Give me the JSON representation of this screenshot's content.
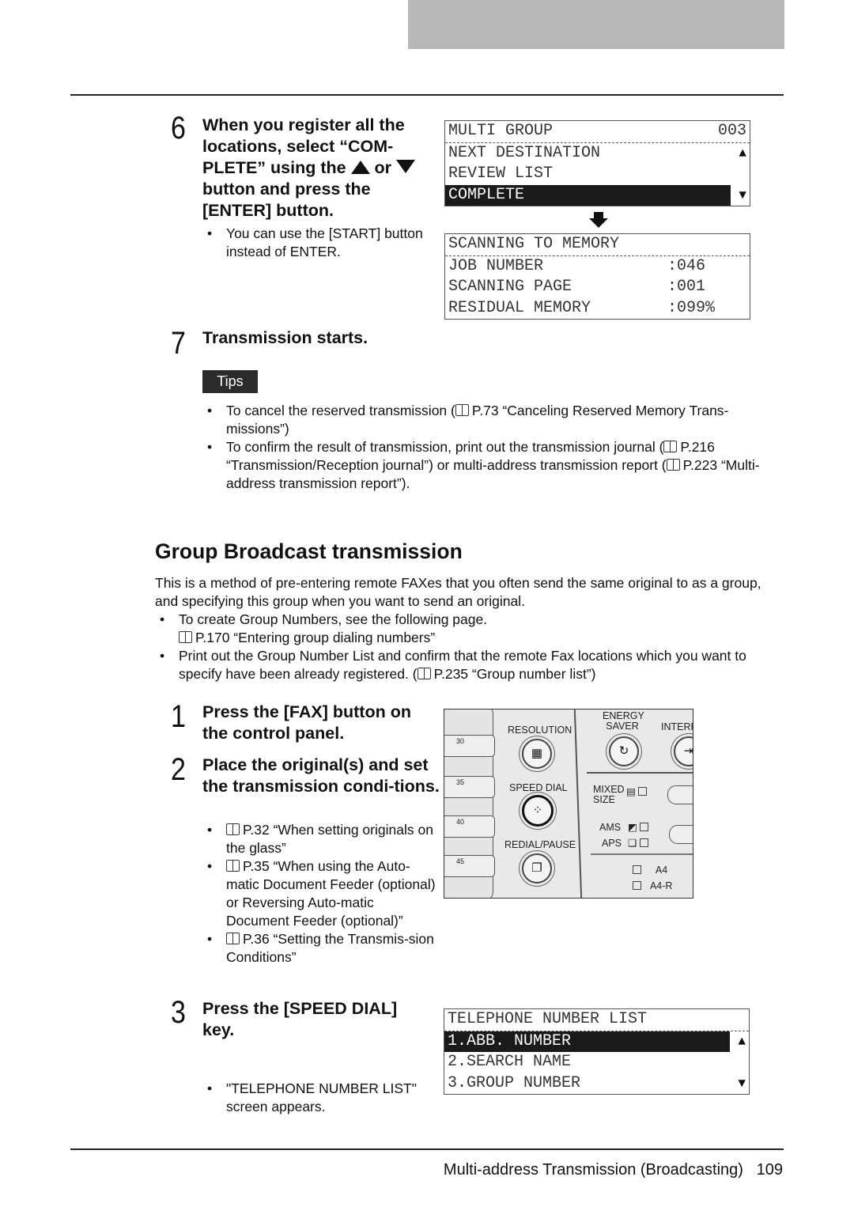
{
  "step6": {
    "num": "6",
    "heading": "When you register all the locations, select “COM-PLETE” using the",
    "heading_or": "or",
    "heading_end": "button and press the [ENTER] button.",
    "bullets": [
      "You can use the [START] button instead of ENTER."
    ]
  },
  "lcd1": {
    "title": "MULTI GROUP",
    "count": "003",
    "rows": [
      "NEXT DESTINATION",
      "REVIEW LIST",
      "COMPLETE"
    ],
    "selected": "COMPLETE"
  },
  "lcd2": {
    "title": "SCANNING TO MEMORY",
    "rows": [
      {
        "label": "JOB NUMBER",
        "value": ":046"
      },
      {
        "label": "SCANNING PAGE",
        "value": ":001"
      },
      {
        "label": "RESIDUAL MEMORY",
        "value": ":099%"
      }
    ]
  },
  "step7": {
    "num": "7",
    "heading": "Transmission starts."
  },
  "tips": {
    "label": "Tips",
    "items": [
      {
        "pre": "To cancel the reserved transmission (",
        "ref": "P.73 “Canceling Reserved Memory Trans-missions”)"
      },
      {
        "pre": "To confirm the result of transmission, print out the transmission journal (",
        "ref": "P.216 “Transmission/Reception journal”) or multi-address transmission report (",
        "ref2": "P.223 “Multi-address transmission report”)."
      }
    ]
  },
  "section": {
    "title": "Group Broadcast transmission",
    "intro": "This is a method of pre-entering remote FAXes that you often send the same original to as a group, and specifying this group when you want to send an original.",
    "bullets": [
      {
        "text": "To create Group Numbers, see the following page.",
        "ref": "P.170 “Entering group dialing numbers”"
      },
      {
        "text": "Print out the Group Number List and confirm that the remote Fax locations which you want to specify have been already registered. (",
        "ref": "P.235 “Group number list”)"
      }
    ]
  },
  "step1": {
    "num": "1",
    "heading": "Press the [FAX] button on the control panel."
  },
  "step2": {
    "num": "2",
    "heading": "Place the original(s) and set the transmission condi-tions.",
    "bullets": [
      "P.32 “When setting originals on the glass”",
      "P.35 “When using the Auto-matic Document Feeder (optional) or Reversing Auto-matic Document Feeder (optional)”",
      "P.36 “Setting the Transmis-sion Conditions”"
    ]
  },
  "step3": {
    "num": "3",
    "heading": "Press the [SPEED DIAL] key.",
    "bullets": [
      "\"TELEPHONE NUMBER LIST\" screen appears."
    ]
  },
  "panel": {
    "resolution": "RESOLUTION",
    "speed_dial": "SPEED DIAL",
    "redial": "REDIAL/PAUSE",
    "energy_saver": "ENERGY SAVER",
    "interrupt": "INTERR",
    "mixed_size": "MIXED SIZE",
    "ams": "AMS",
    "aps": "APS",
    "a4": "A4",
    "a4r": "A4-R",
    "keys": [
      "30",
      "35",
      "40",
      "45"
    ]
  },
  "lcd3": {
    "title": "TELEPHONE NUMBER LIST",
    "rows": [
      "1.ABB. NUMBER",
      "2.SEARCH NAME",
      "3.GROUP NUMBER"
    ],
    "selected": "1.ABB. NUMBER"
  },
  "footer": {
    "title": "Multi-address Transmission (Broadcasting)",
    "page": "109"
  }
}
